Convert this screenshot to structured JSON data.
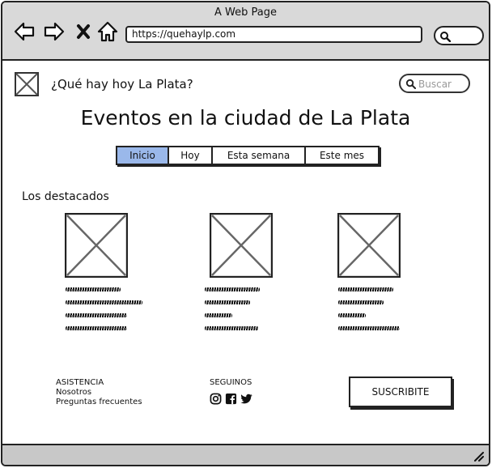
{
  "browser": {
    "window_title": "A Web Page",
    "url": "https://quehaylp.com"
  },
  "header": {
    "site_title": "¿Qué hay hoy La Plata?",
    "search_placeholder": "Buscar"
  },
  "main": {
    "heading": "Eventos en la ciudad de La Plata",
    "tabs": [
      {
        "label": "Inicio",
        "active": true
      },
      {
        "label": "Hoy",
        "active": false
      },
      {
        "label": "Esta semana",
        "active": false
      },
      {
        "label": "Este mes",
        "active": false
      }
    ],
    "featured_title": "Los destacados"
  },
  "footer": {
    "assistance_heading": "ASISTENCIA",
    "assistance_links": [
      "Nosotros",
      "Preguntas frecuentes"
    ],
    "follow_heading": "SEGUINOS",
    "social_icons": [
      "instagram-icon",
      "facebook-icon",
      "twitter-icon"
    ],
    "subscribe_label": "SUSCRIBITE"
  },
  "colors": {
    "active_tab": "#9ab8ea",
    "chrome": "#d9d9d9"
  }
}
